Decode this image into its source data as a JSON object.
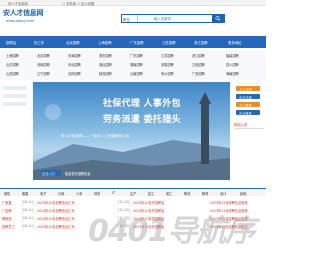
{
  "topbar": {
    "welcome": "安人才信息网",
    "fav": "设为首页",
    "links": "☐ 手机版  ☐ 加入收藏"
  },
  "logo": {
    "title": "安人才信息网",
    "url": "www.jobxx.com"
  },
  "search": {
    "select": "职位",
    "placeholder": "输入关键词"
  },
  "region_nav": [
    "招聘会",
    "找工作",
    "北京招聘",
    "上海招聘",
    "广东招聘",
    "江苏招聘",
    "浙江招聘",
    "更多地区"
  ],
  "sub_links": [
    [
      "上海招聘",
      "北京招聘",
      "天津招聘",
      "重庆招聘",
      "广东招聘",
      "江苏招聘",
      "浙江招聘",
      "福建招聘"
    ],
    [
      "山东招聘",
      "河南招聘",
      "河北招聘",
      "湖北招聘",
      "湖南招聘",
      "安徽招聘",
      "江西招聘",
      "四川招聘"
    ],
    [
      "山西招聘",
      "辽宁招聘",
      "吉林招聘",
      "陕西招聘",
      "云南招聘",
      "贵州招聘",
      "广西招聘",
      "海南招聘"
    ]
  ],
  "banner": {
    "line1": "社保代理   人事外包",
    "line2": "劳务派遣   委托猎头",
    "caption": "安人才信息网——一站式人力资源服务平台",
    "company_btn": "企业入口",
    "company_text": "免费发布招聘信息"
  },
  "login": {
    "btn1": "个人注册",
    "btn2": "企业注册",
    "btn3": "个人登录",
    "btn4": "企业登录",
    "notice": "网站公告"
  },
  "categories": [
    "销售",
    "客服",
    "电子",
    "行政",
    "人事",
    "财务",
    "IT",
    "生产",
    "技工",
    "普工",
    "物流",
    "教育",
    "设计",
    "其他"
  ],
  "news": {
    "col1": [
      {
        "tag": "[08-10]",
        "text": "2023年12月招聘信息汇总"
      },
      {
        "tag": "[08-10]",
        "text": "2023年12月招聘信息汇总"
      },
      {
        "tag": "[08-10]",
        "text": "2023年12月招聘信息汇总"
      },
      {
        "tag": "[08-10]",
        "text": "2023年12月招聘信息汇总"
      }
    ],
    "col2": [
      {
        "tag": "[12-30]",
        "text": "2023年12月份招聘会"
      },
      {
        "tag": "[12-30]",
        "text": "2023年12月份招聘会"
      },
      {
        "tag": "[12-30]",
        "text": "2023年12月份招聘会"
      },
      {
        "tag": "[12-30]",
        "text": "2023年12月份招聘会"
      }
    ],
    "col3": [
      {
        "text": "2023年12月招聘信息查看"
      },
      {
        "text": "2023年12月招聘信息查看"
      },
      {
        "text": "2023年12月招聘信息查看"
      },
      {
        "text": "2023年12月招聘信息查看"
      }
    ],
    "left_tags": [
      "厂家直",
      "厂招聘",
      "聘销售",
      "招聘员工"
    ]
  },
  "watermark": "0401导航序",
  "colors": {
    "brand": "#2567b9",
    "link_red": "#d0342c",
    "orange": "#f08c1e"
  }
}
